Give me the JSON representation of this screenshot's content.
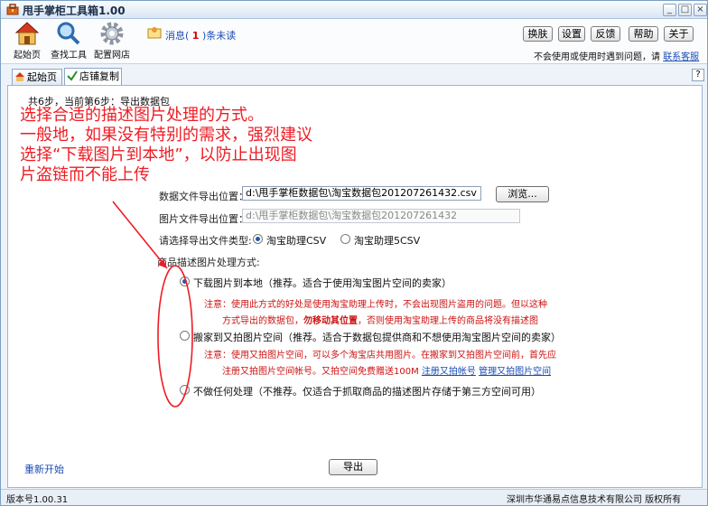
{
  "window": {
    "title": "甩手掌柜工具箱1.00",
    "controls": [
      "_",
      "□",
      "×"
    ]
  },
  "toolbar": {
    "tools": [
      "起始页",
      "查找工具",
      "配置网店"
    ],
    "message": {
      "prefix": "消息(",
      "count": "1",
      "suffix": ")条未读"
    },
    "buttons": {
      "skin": "换肤",
      "settings": "设置",
      "feedback": "反馈",
      "help": "帮助",
      "close": "关于"
    },
    "notice": "不会使用或使用时遇到问题，请",
    "notice_link": "联系客服"
  },
  "tabs": {
    "home": "起始页",
    "copy": "店铺复制",
    "help": "?"
  },
  "content": {
    "step": "共6步，当前第6步：导出数据包",
    "annotation": [
      "选择合适的描述图片处理的方式。",
      "一般地，如果没有特别的需求，强烈建议",
      "选择“下载图片到本地”，以防止出现图",
      "片盗链而不能上传"
    ],
    "data_label": "数据文件导出位置：",
    "data_value": "d:\\甩手掌柜数据包\\淘宝数据包201207261432.csv",
    "browse": "浏览...",
    "img_label": "图片文件导出位置：",
    "img_value": "d:\\甩手掌柜数据包\\淘宝数据包201207261432",
    "type_label": "请选择导出文件类型:",
    "type_opt1": "淘宝助理CSV",
    "type_opt2": "淘宝助理5CSV",
    "desc_label": "商品描述图片处理方式:",
    "opt1": "下载图片到本地（推荐。适合于使用淘宝图片空间的卖家）",
    "note1_a": "注意：使用此方式的好处是使用淘宝助理上传时，不会出现图片盗用的问题。但以这种",
    "note1_b_pre": "方式导出的数据包，",
    "note1_b_bold": "勿移动其位置",
    "note1_b_post": "，否则使用淘宝助理上传的商品将没有描述图",
    "opt2": "搬家到又拍图片空间（推荐。适合于数据包提供商和不想使用淘宝图片空间的卖家）",
    "note2_a": "注意：使用又拍图片空间，可以多个淘宝店共用图片。在搬家到又拍图片空间前，首先应",
    "note2_b": "注册又拍图片空间帐号。又拍空间免费赠送100M",
    "note2_link1": "注册又拍帐号",
    "note2_link2": "管理又拍图片空间",
    "opt3": "不做任何处理（不推荐。仅适合于抓取商品的描述图片存储于第三方空间可用）",
    "restart": "重新开始",
    "export": "导出"
  },
  "statusbar": {
    "version": "版本号1.00.31",
    "copyright": "深圳市华通易点信息技术有限公司 版权所有"
  },
  "colors": {
    "annotation": "#ee1c24",
    "link": "#1a4db3",
    "note": "#cc1111"
  }
}
